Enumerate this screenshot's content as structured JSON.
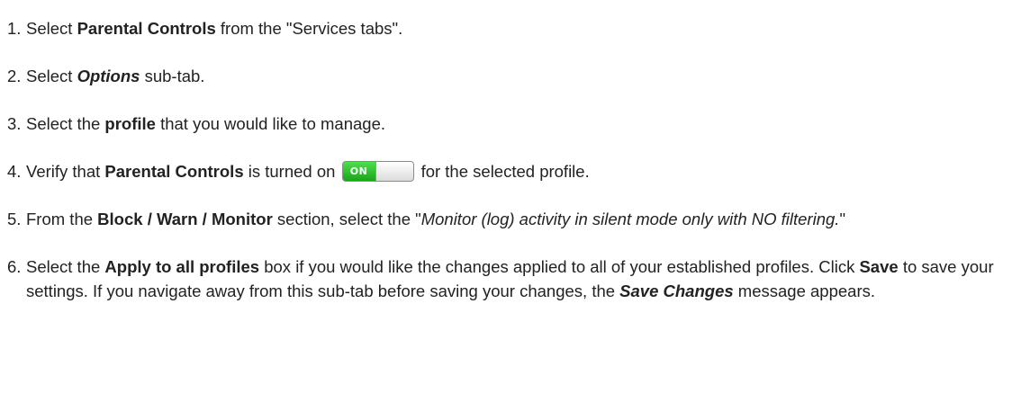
{
  "steps": [
    {
      "num": "1.",
      "t1": "Select ",
      "b1": "Parental Controls",
      "t2": " from the \"Services tabs\"."
    },
    {
      "num": "2.",
      "t1": "Select ",
      "bi1": "Options",
      "t2": " sub-tab."
    },
    {
      "num": "3.",
      "t1": "Select the ",
      "b1": "profile",
      "t2": " that you would like to manage."
    },
    {
      "num": "4.",
      "t1": "Verify that ",
      "b1": "Parental Controls",
      "t2": " is turned on ",
      "toggle_label": "ON",
      "t3": "for the selected profile."
    },
    {
      "num": "5.",
      "t1": "From the ",
      "b1": "Block / Warn / Monitor",
      "t2": " section, select the \"",
      "i1": "Monitor (log) activity in silent mode only with NO filtering.",
      "t3": "\""
    },
    {
      "num": "6.",
      "t1": "Select the ",
      "b1": "Apply to all profiles",
      "t2": " box if you would like the changes applied to all of your established profiles. Click ",
      "b2": "Save",
      "t3": " to save your settings. If you navigate away from this sub-tab before saving your changes, the ",
      "bi1": "Save Changes",
      "t4": " message appears."
    }
  ],
  "colors": {
    "text": "#222222",
    "toggle_on": "#2fc22f"
  },
  "icons": {
    "toggle": "on-off-toggle-icon"
  }
}
